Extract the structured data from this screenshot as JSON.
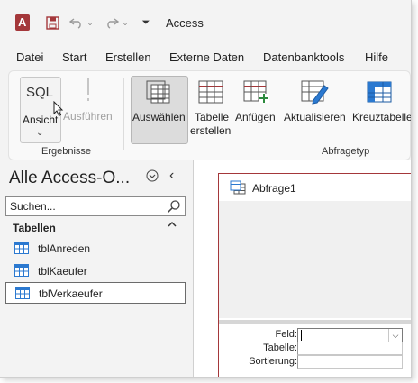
{
  "titlebar": {
    "title": "Access",
    "app_icon_letter": "A",
    "accent": "#a4373a"
  },
  "menu": [
    "Datei",
    "Start",
    "Erstellen",
    "Externe Daten",
    "Datenbanktools",
    "Hilfe"
  ],
  "ribbon": {
    "sql_label": "SQL",
    "ansicht_label": "Ansicht",
    "ausfuehren_label": "Ausführen",
    "group_ergebnisse": "Ergebnisse",
    "auswaehlen_label": "Auswählen",
    "tabelle_label_1": "Tabelle",
    "tabelle_label_2": "erstellen",
    "anfuegen_label": "Anfügen",
    "aktualisieren_label": "Aktualisieren",
    "kreuztabelle_label": "Kreuztabelle",
    "group_abfragetyp": "Abfragetyp"
  },
  "nav": {
    "title": "Alle Access-O...",
    "search_placeholder": "Suchen...",
    "section": "Tabellen",
    "tables": [
      "tblAnreden",
      "tblKaeufer",
      "tblVerkaeufer"
    ]
  },
  "query": {
    "title": "Abfrage1",
    "rows": [
      "Feld:",
      "Tabelle:",
      "Sortierung:"
    ]
  }
}
